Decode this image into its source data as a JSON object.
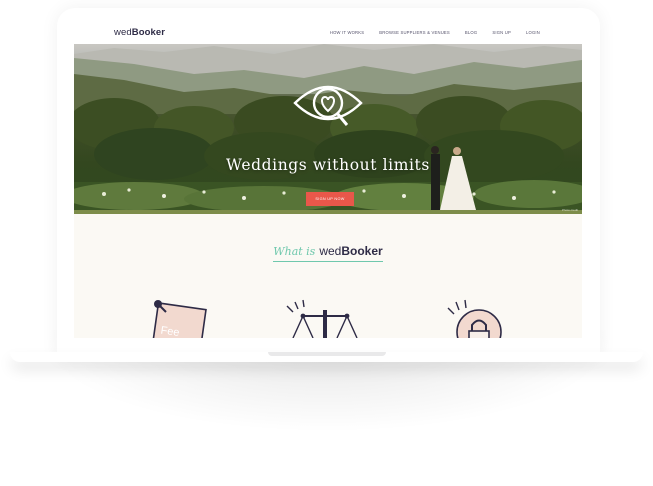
{
  "site": {
    "logo_light": "wed",
    "logo_bold": "Booker"
  },
  "nav": {
    "items": [
      "HOW IT WORKS",
      "BROWSE SUPPLIERS & VENUES",
      "BLOG",
      "SIGN UP",
      "LOGIN"
    ]
  },
  "hero": {
    "title": "Weddings without limits",
    "cta_label": "SIGN UP NOW",
    "credit": "Photo credit"
  },
  "about": {
    "script_text": "What is",
    "brand_light": "wed",
    "brand_bold": "Booker"
  },
  "features": {
    "icons": [
      "pinned-note-icon",
      "scales-icon",
      "padlock-icon"
    ],
    "note_text": "Fee"
  },
  "colors": {
    "accent_mint": "#6fc8ad",
    "cta_red": "#e9574a",
    "brand_navy": "#2e2b46",
    "page_cream": "#fbf9f4",
    "icon_pink": "#f2d9cf"
  }
}
